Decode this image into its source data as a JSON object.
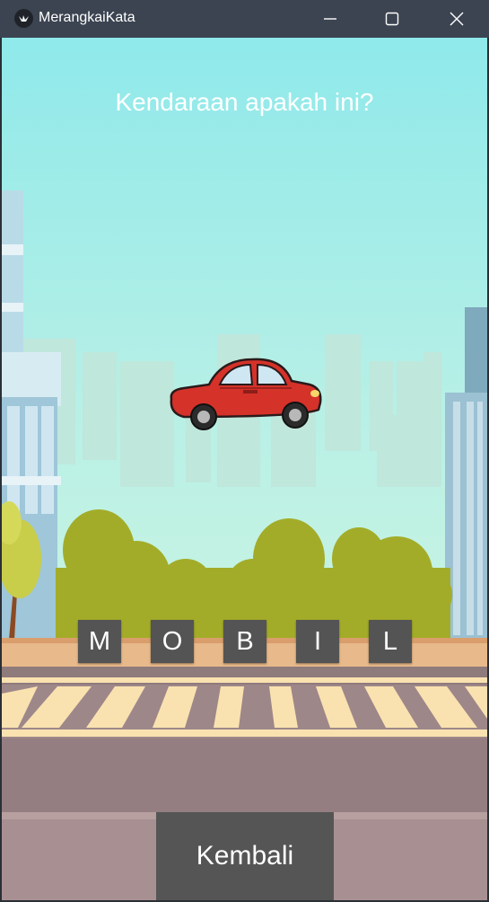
{
  "window": {
    "title": "MerangkaiKata",
    "app_icon": "kivy-logo-icon",
    "controls": [
      "minimize-icon",
      "maximize-icon",
      "close-icon"
    ]
  },
  "game": {
    "question": "Kendaraan apakah ini?",
    "picture": "red-car",
    "letters": [
      "M",
      "O",
      "B",
      "I",
      "L"
    ],
    "back_label": "Kembali"
  },
  "colors": {
    "titlebar": "#3c4451",
    "sky_top": "#8fe9ea",
    "tile": "#545454",
    "back_button": "#555555",
    "car_body": "#d5322a"
  }
}
